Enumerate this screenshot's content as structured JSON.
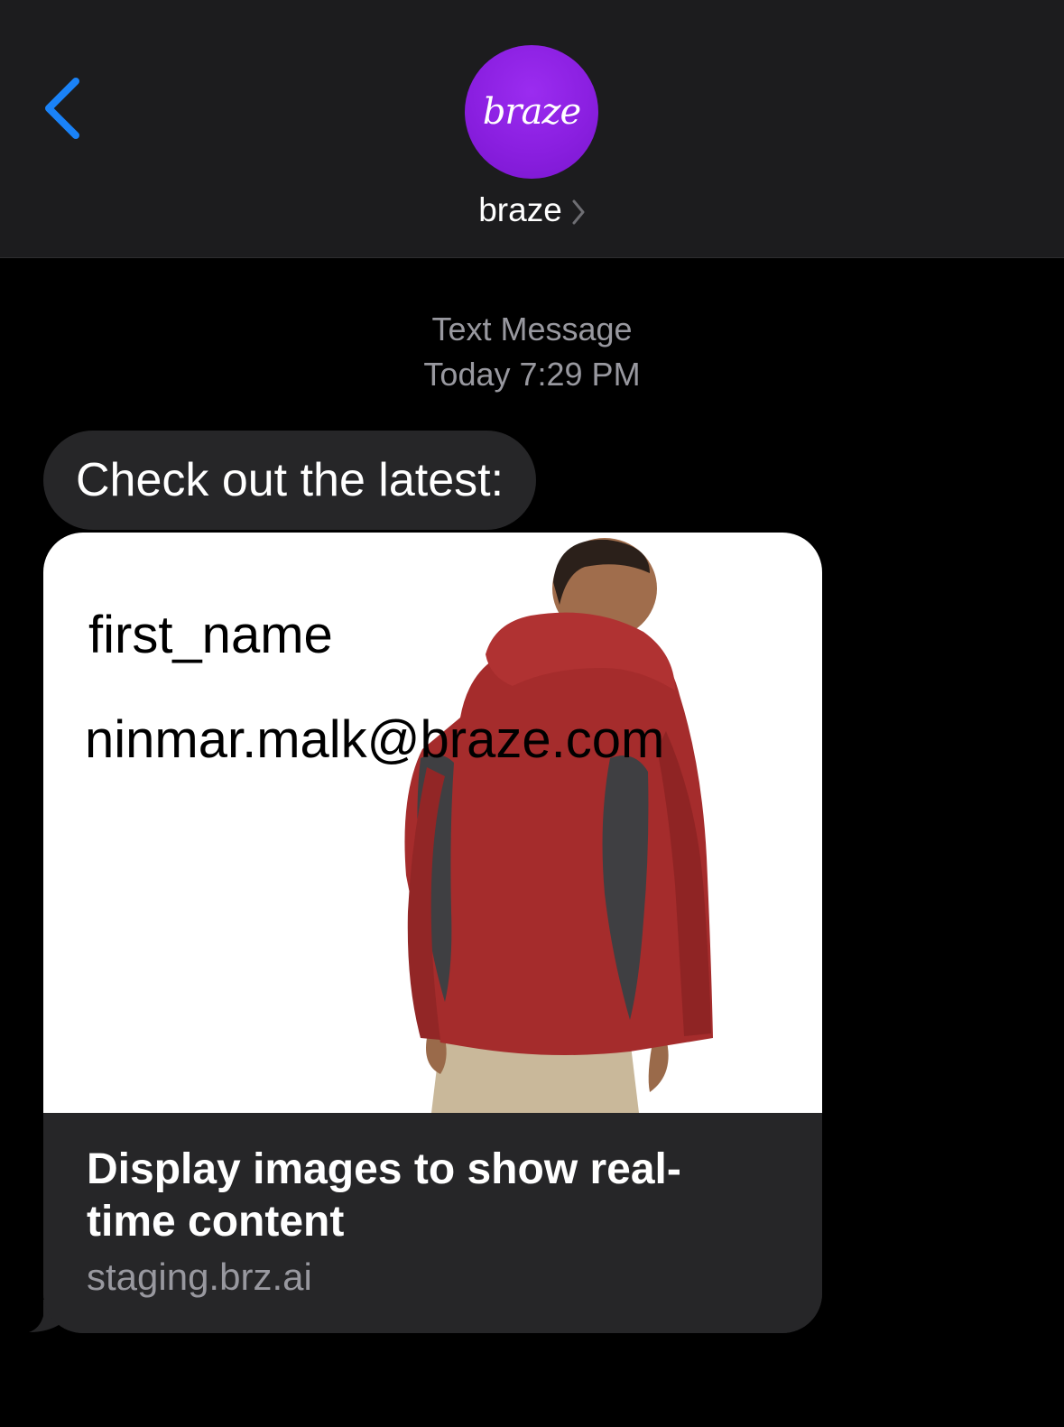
{
  "header": {
    "contact_name": "braze",
    "avatar_text": "braze",
    "avatar_color": "#8a1fe0",
    "back_icon": "chevron-left-icon",
    "accent_color": "#1a82f7"
  },
  "thread": {
    "service": "Text Message",
    "timestamp": "Today 7:29 PM"
  },
  "messages": [
    {
      "text": "Check out the latest:"
    }
  ],
  "link_preview": {
    "image_lines": [
      "first_name",
      "ninmar.malk@braze.com"
    ],
    "title": "Display images to show real-time content",
    "domain": "staging.brz.ai"
  }
}
